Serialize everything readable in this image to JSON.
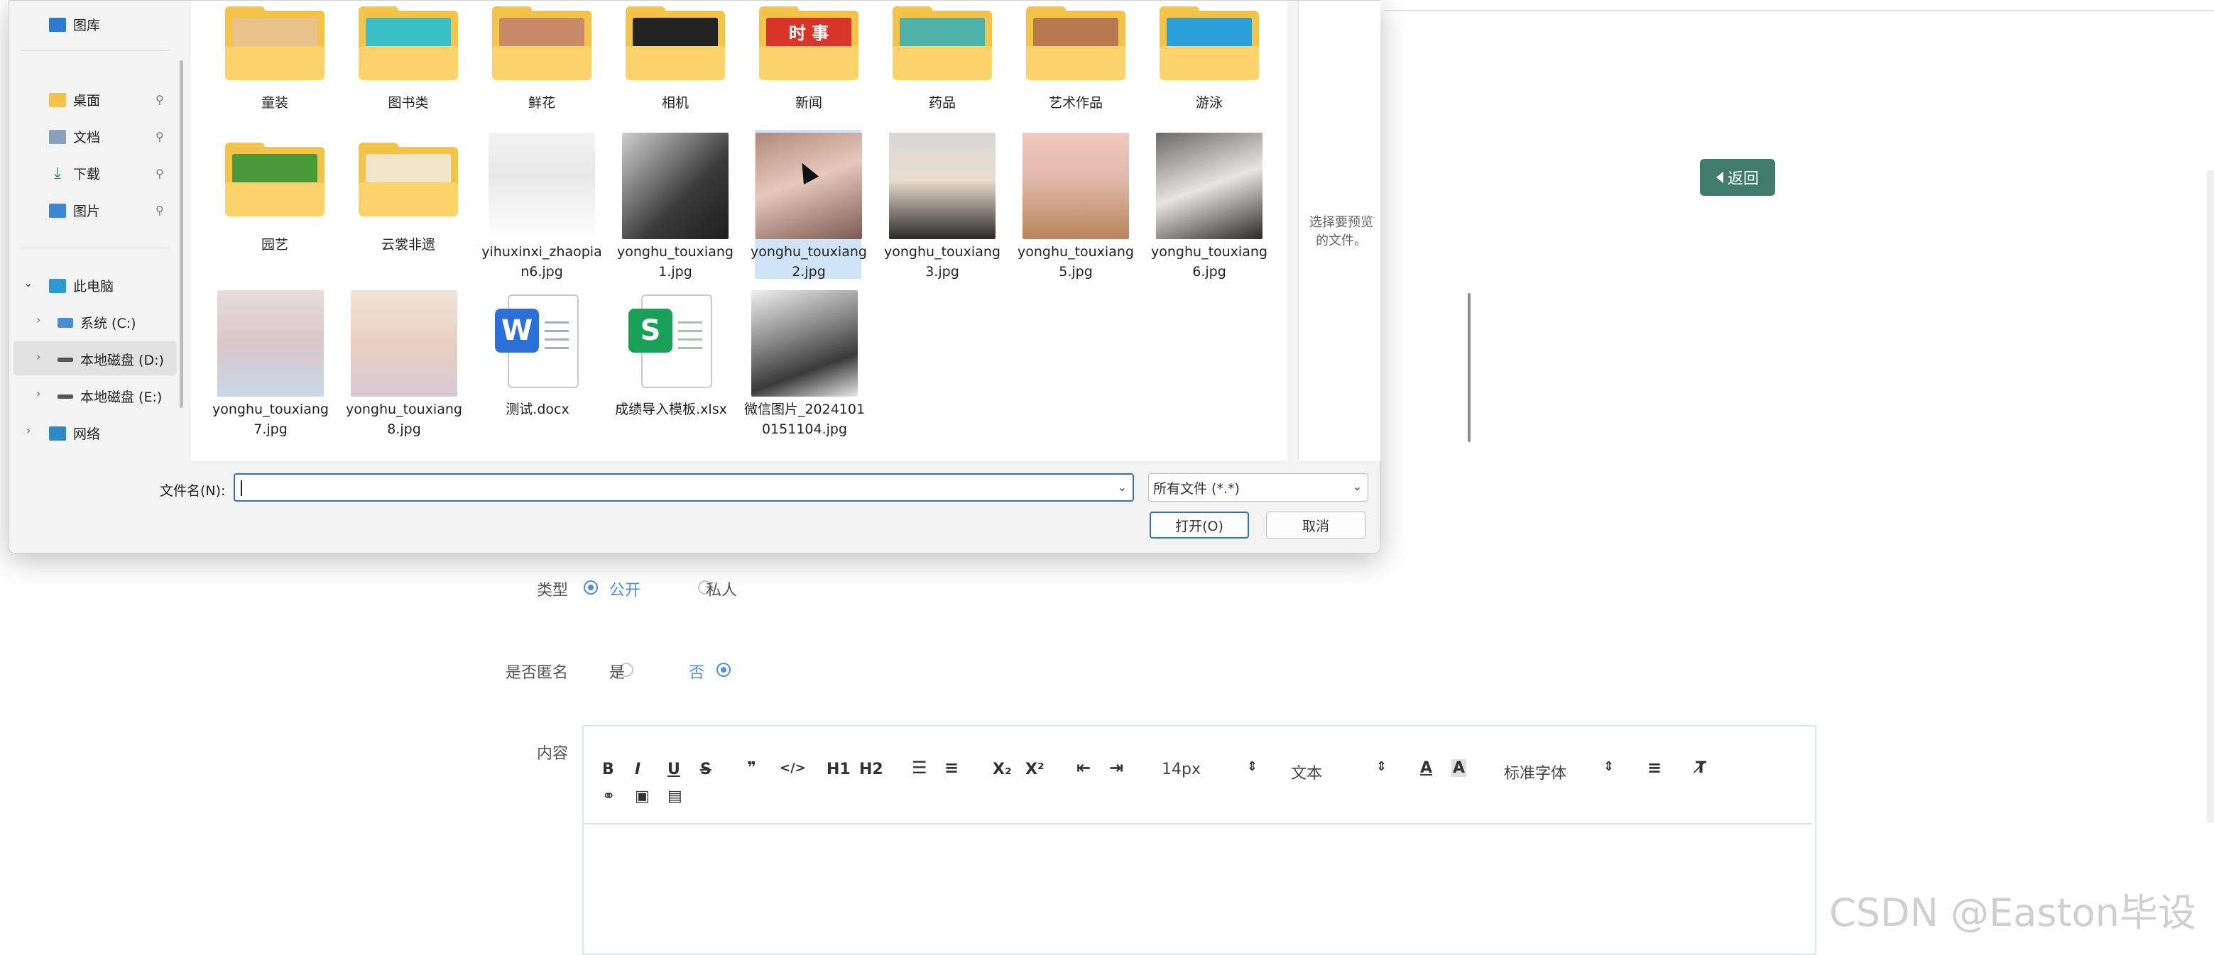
{
  "page": {
    "back_label": "返回",
    "form": {
      "type_label": "类型",
      "type_options": [
        "公开",
        "私人"
      ],
      "type_selected": "公开",
      "anon_label": "是否匿名",
      "anon_options": [
        "是",
        "否"
      ],
      "anon_selected": "否",
      "content_label": "内容"
    },
    "editor_toolbar": {
      "buttons": [
        "B",
        "I",
        "U",
        "S",
        "❞",
        "</>",
        "H1",
        "H2",
        "ordered-list",
        "bullet-list",
        "X₂",
        "X²",
        "outdent",
        "indent",
        "text-color",
        "background-color",
        "align",
        "clear-format",
        "link",
        "image",
        "video"
      ],
      "font_size": "14px",
      "paragraph": "文本",
      "font_family": "标准字体"
    },
    "watermark": "CSDN @Easton毕设"
  },
  "dialog": {
    "nav": {
      "items": [
        {
          "label": "图库",
          "icon": "gallery-icon",
          "pinned": false
        },
        {
          "label": "桌面",
          "icon": "desktop-folder-icon",
          "pinned": true
        },
        {
          "label": "文档",
          "icon": "documents-icon",
          "pinned": true
        },
        {
          "label": "下载",
          "icon": "download-icon",
          "pinned": true
        },
        {
          "label": "图片",
          "icon": "pictures-icon",
          "pinned": true
        },
        {
          "label": "此电脑",
          "icon": "this-pc-icon",
          "expanded": true
        },
        {
          "label": "系统 (C:)",
          "icon": "drive-c-icon"
        },
        {
          "label": "本地磁盘 (D:)",
          "icon": "drive-icon",
          "selected": true
        },
        {
          "label": "本地磁盘 (E:)",
          "icon": "drive-icon"
        },
        {
          "label": "网络",
          "icon": "network-icon"
        }
      ]
    },
    "folders_row1": [
      "童装",
      "图书类",
      "鲜花",
      "相机",
      "新闻",
      "药品",
      "艺术作品",
      "游泳"
    ],
    "row2": [
      {
        "name": "园艺",
        "kind": "folder"
      },
      {
        "name": "云裳非遗",
        "kind": "folder"
      },
      {
        "name": "yihuxinxi_zhaopian6.jpg",
        "kind": "photo"
      },
      {
        "name": "yonghu_touxiang1.jpg",
        "kind": "photo"
      },
      {
        "name": "yonghu_touxiang2.jpg",
        "kind": "photo",
        "selected": true
      },
      {
        "name": "yonghu_touxiang3.jpg",
        "kind": "photo"
      },
      {
        "name": "yonghu_touxiang5.jpg",
        "kind": "photo"
      },
      {
        "name": "yonghu_touxiang6.jpg",
        "kind": "photo"
      }
    ],
    "row3": [
      {
        "name": "yonghu_touxiang7.jpg",
        "kind": "photo"
      },
      {
        "name": "yonghu_touxiang8.jpg",
        "kind": "photo"
      },
      {
        "name": "测试.docx",
        "kind": "word"
      },
      {
        "name": "成绩导入模板.xlsx",
        "kind": "excel"
      },
      {
        "name": "微信图片_20241010151104.jpg",
        "kind": "photo"
      }
    ],
    "news_folder_text": "时 事",
    "word_badge": "W",
    "excel_badge": "S",
    "preview_text": "选择要预览的文件。",
    "filename_label": "文件名(N):",
    "filename_value": "",
    "filetype": "所有文件 (*.*)",
    "open_button": "打开(O)",
    "cancel_button": "取消"
  }
}
